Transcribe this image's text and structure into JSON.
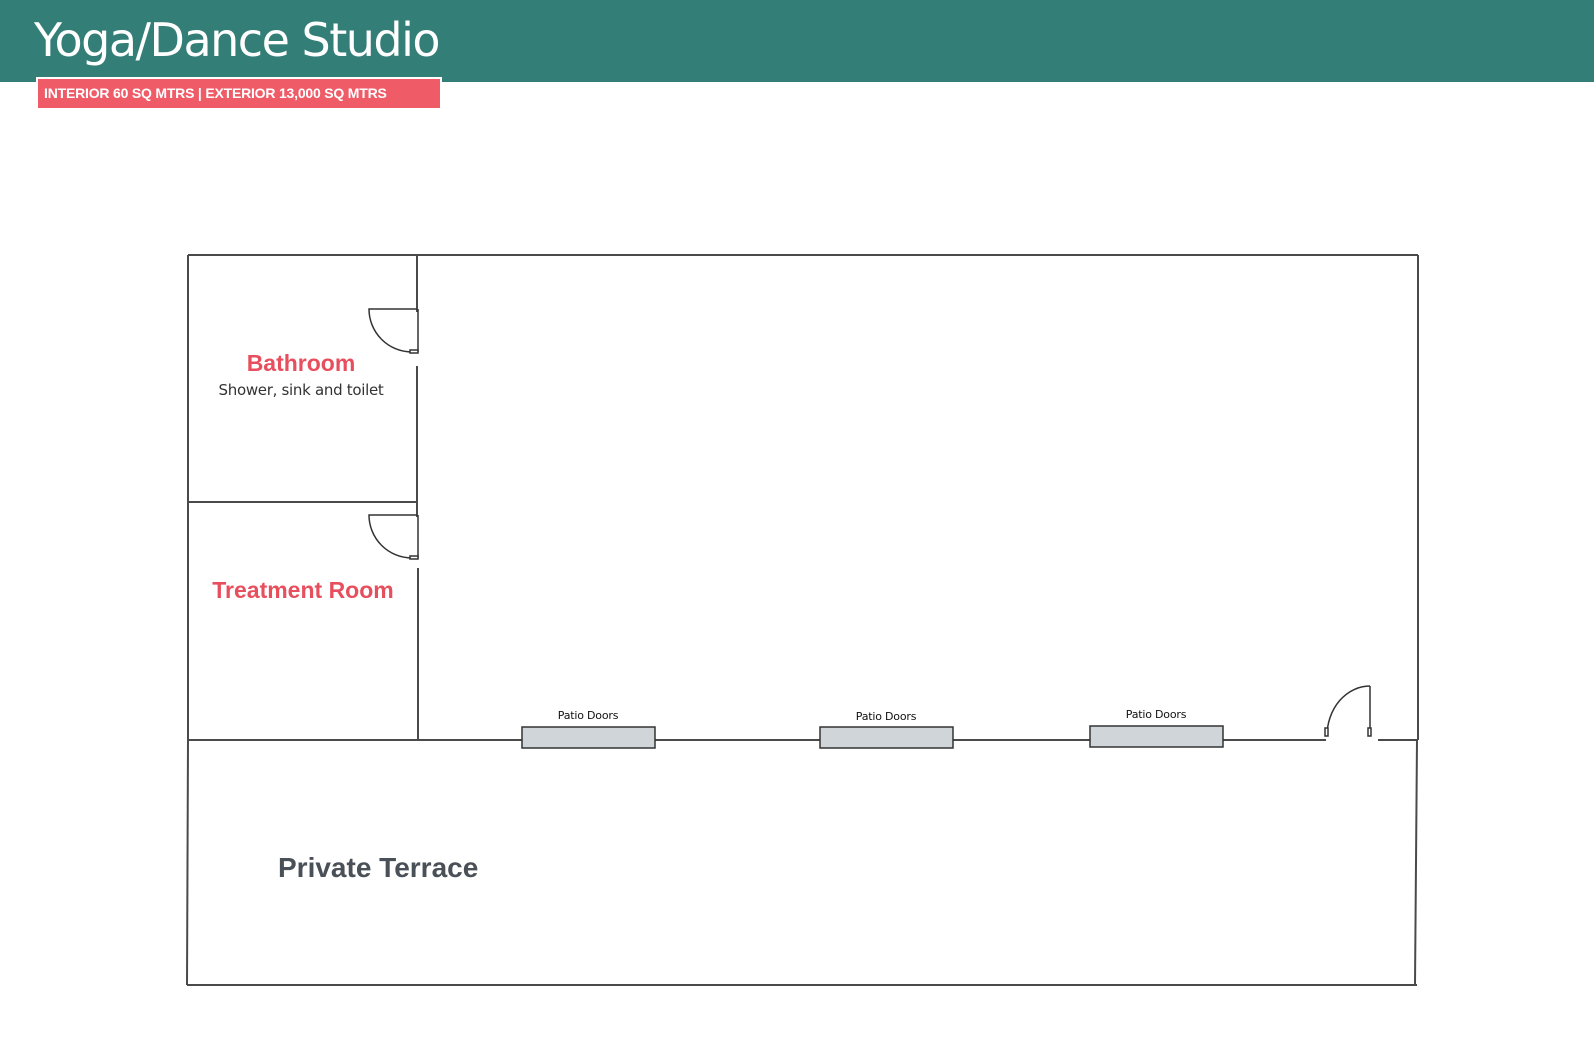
{
  "header": {
    "title": "Yoga/Dance Studio",
    "area_badge": "INTERIOR 60 SQ MTRS | EXTERIOR 13,000 SQ MTRS"
  },
  "rooms": {
    "bathroom": {
      "title": "Bathroom",
      "subtitle": "Shower, sink and toilet"
    },
    "treatment": {
      "title": "Treatment Room"
    },
    "terrace": {
      "title": "Private Terrace"
    }
  },
  "patio_doors": [
    {
      "label": "Patio Doors"
    },
    {
      "label": "Patio Doors"
    },
    {
      "label": "Patio Doors"
    }
  ],
  "colors": {
    "header_band": "#347e78",
    "accent_red": "#ef5c68",
    "room_label_red": "#e84f5e",
    "wall": "#4a4a4a",
    "patio_door_fill": "#cfd5d8"
  }
}
